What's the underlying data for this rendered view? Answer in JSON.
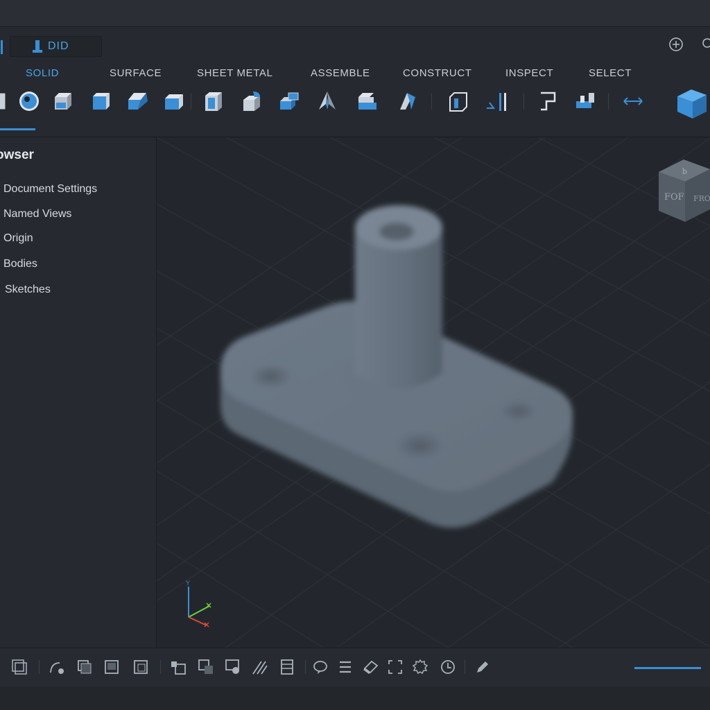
{
  "document": {
    "tab_name": "DID"
  },
  "menu": {
    "tabs": [
      {
        "label": "SOLID",
        "active": true
      },
      {
        "label": "SURFACE"
      },
      {
        "label": "SHEET METAL"
      },
      {
        "label": "ASSEMBLE"
      },
      {
        "label": "CONSTRUCT"
      },
      {
        "label": "INSPECT"
      },
      {
        "label": "SELECT"
      }
    ]
  },
  "toolbar": {
    "tools": [
      "sketch-tool-icon",
      "sphere-icon",
      "box-icon",
      "box-icon",
      "extrude-icon",
      "shell-icon",
      "cylinder-icon",
      "fillet-icon",
      "combine-icon",
      "loft-icon",
      "press-pull-icon",
      "split-body-icon",
      "plane-icon",
      "offset-plane-icon",
      "midplane-icon",
      "align-icon",
      "measure-icon",
      "view-cube-icon"
    ]
  },
  "top_right": {
    "icons": [
      "add-icon",
      "search-icon"
    ]
  },
  "browser": {
    "title": "owser",
    "items": [
      "Document Settings",
      "Named Views",
      "Origin",
      "Bodies",
      "Sketches"
    ]
  },
  "viewcube": {
    "top": "b",
    "front": "FOF",
    "right": "FRO"
  },
  "triad": {
    "y_label": "Y"
  },
  "colors": {
    "accent": "#3a8fd6",
    "panel": "#262a30",
    "viewport": "#23272d",
    "model": "#6a7684"
  }
}
